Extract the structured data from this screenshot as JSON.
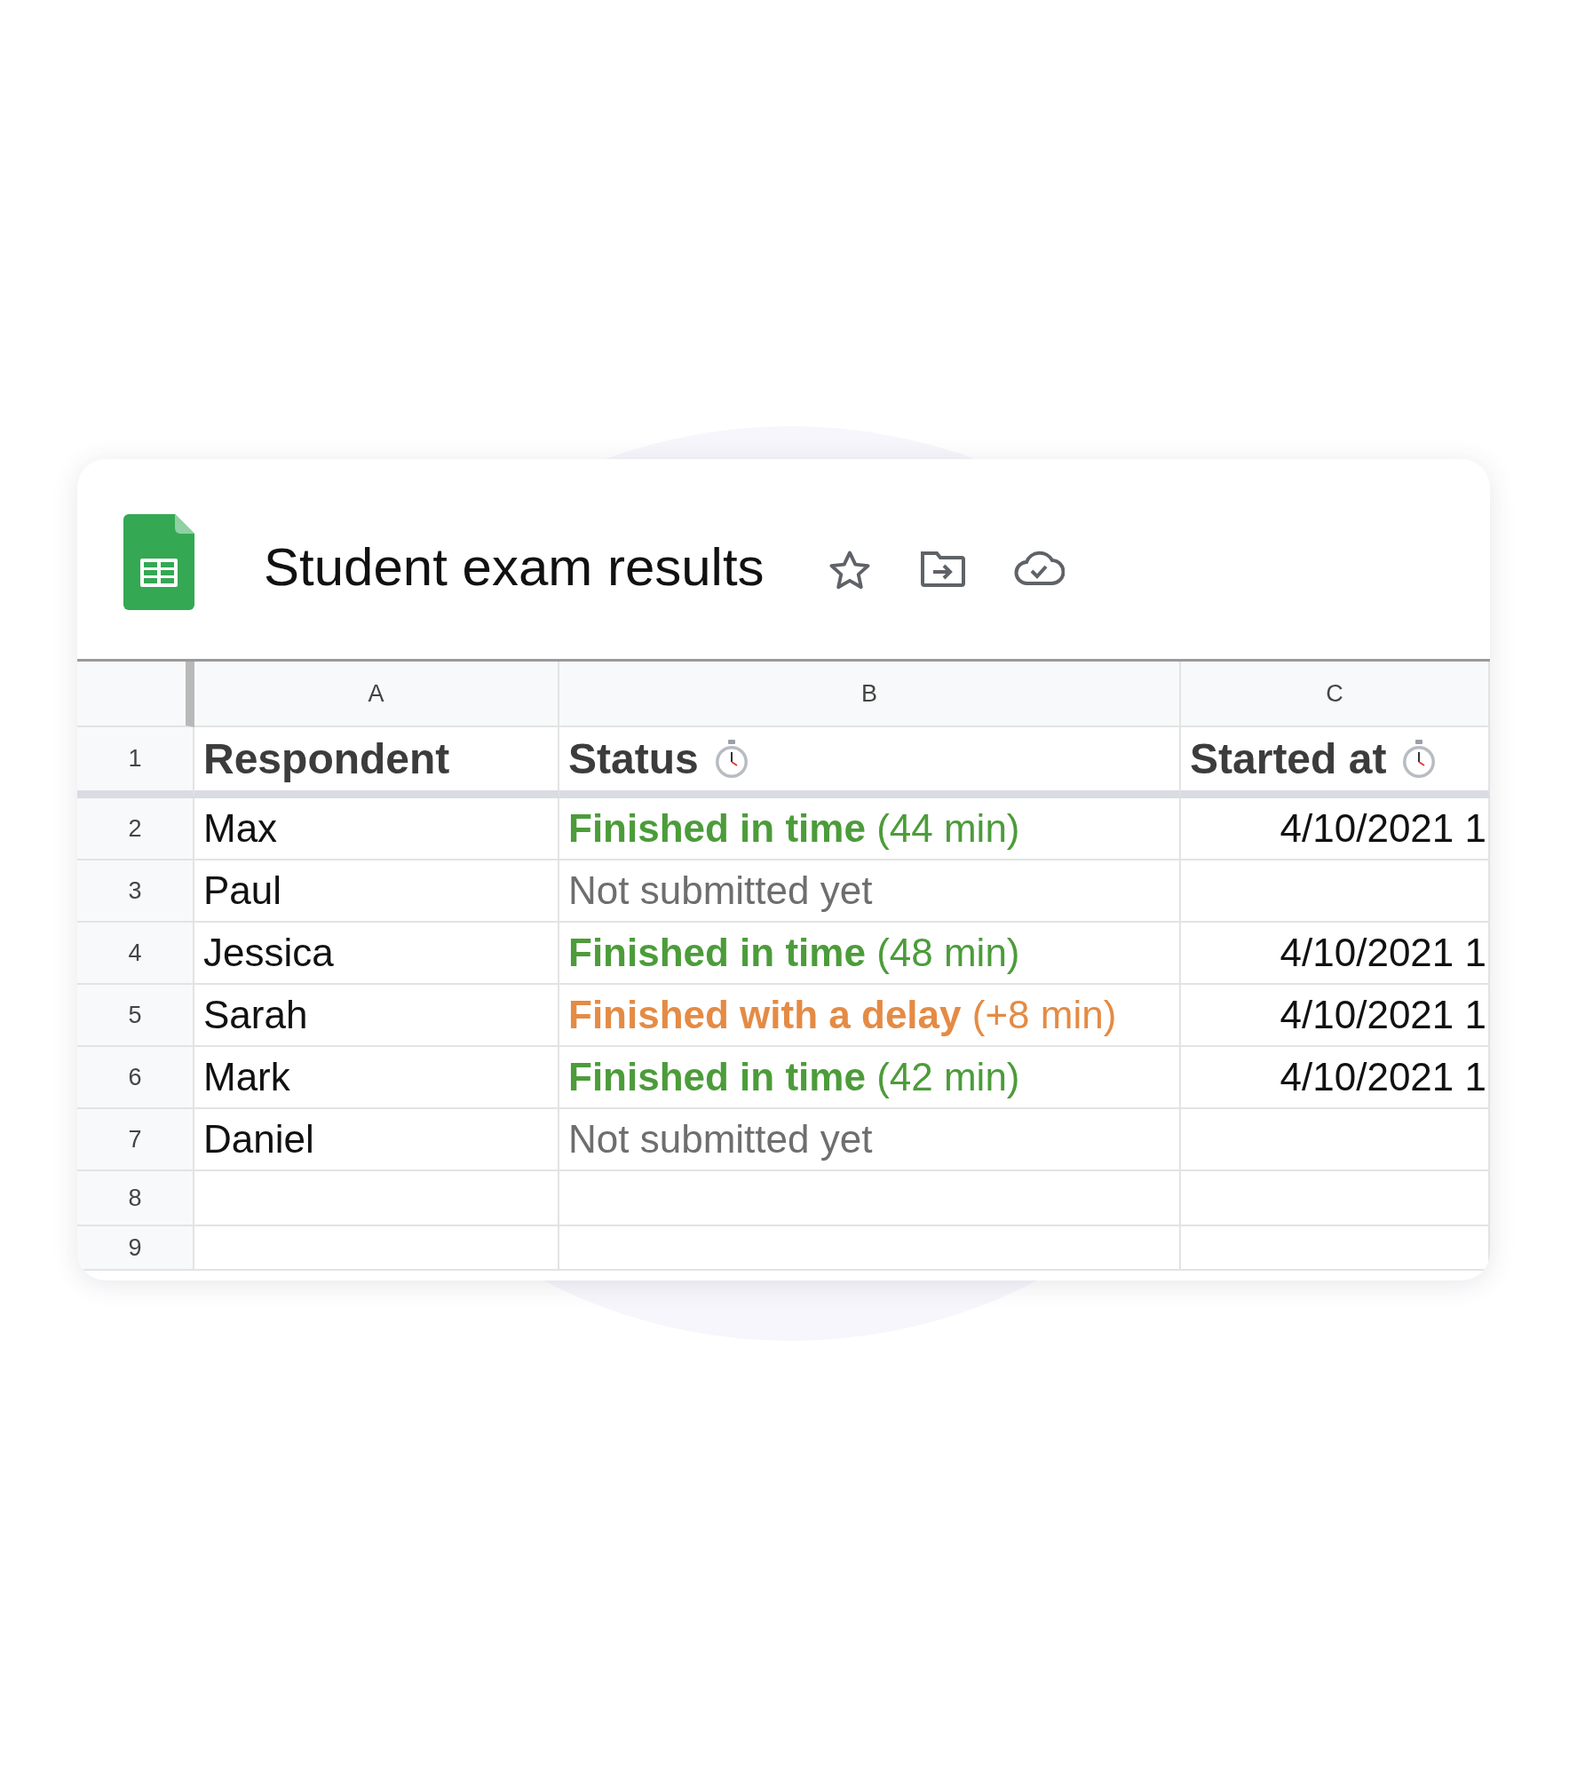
{
  "document": {
    "title": "Student exam results"
  },
  "sheet": {
    "columns": [
      "A",
      "B",
      "C"
    ],
    "header_row": {
      "number": "1",
      "cells": [
        {
          "text": "Respondent",
          "stopwatch": false
        },
        {
          "text": "Status",
          "stopwatch": true
        },
        {
          "text": "Started at",
          "stopwatch": true
        }
      ]
    },
    "rows": [
      {
        "number": "2",
        "respondent": "Max",
        "status": {
          "kind": "in_time",
          "text": "**Finished in time** (44 min)"
        },
        "started_at": "4/10/2021 1"
      },
      {
        "number": "3",
        "respondent": "Paul",
        "status": {
          "kind": "pending",
          "text": "Not submitted yet"
        },
        "started_at": ""
      },
      {
        "number": "4",
        "respondent": "Jessica",
        "status": {
          "kind": "in_time",
          "text": "**Finished in time** (48 min)"
        },
        "started_at": "4/10/2021 1"
      },
      {
        "number": "5",
        "respondent": "Sarah",
        "status": {
          "kind": "delayed",
          "text": "**Finished with a delay** (+8 min)"
        },
        "started_at": "4/10/2021 1"
      },
      {
        "number": "6",
        "respondent": "Mark",
        "status": {
          "kind": "in_time",
          "text": "**Finished in time** (42 min)"
        },
        "started_at": "4/10/2021 1"
      },
      {
        "number": "7",
        "respondent": "Daniel",
        "status": {
          "kind": "pending",
          "text": "Not submitted yet"
        },
        "started_at": ""
      },
      {
        "number": "8",
        "respondent": "",
        "status": {
          "kind": "empty"
        },
        "started_at": ""
      },
      {
        "number": "9",
        "respondent": "",
        "status": {
          "kind": "empty"
        },
        "started_at": ""
      }
    ]
  }
}
